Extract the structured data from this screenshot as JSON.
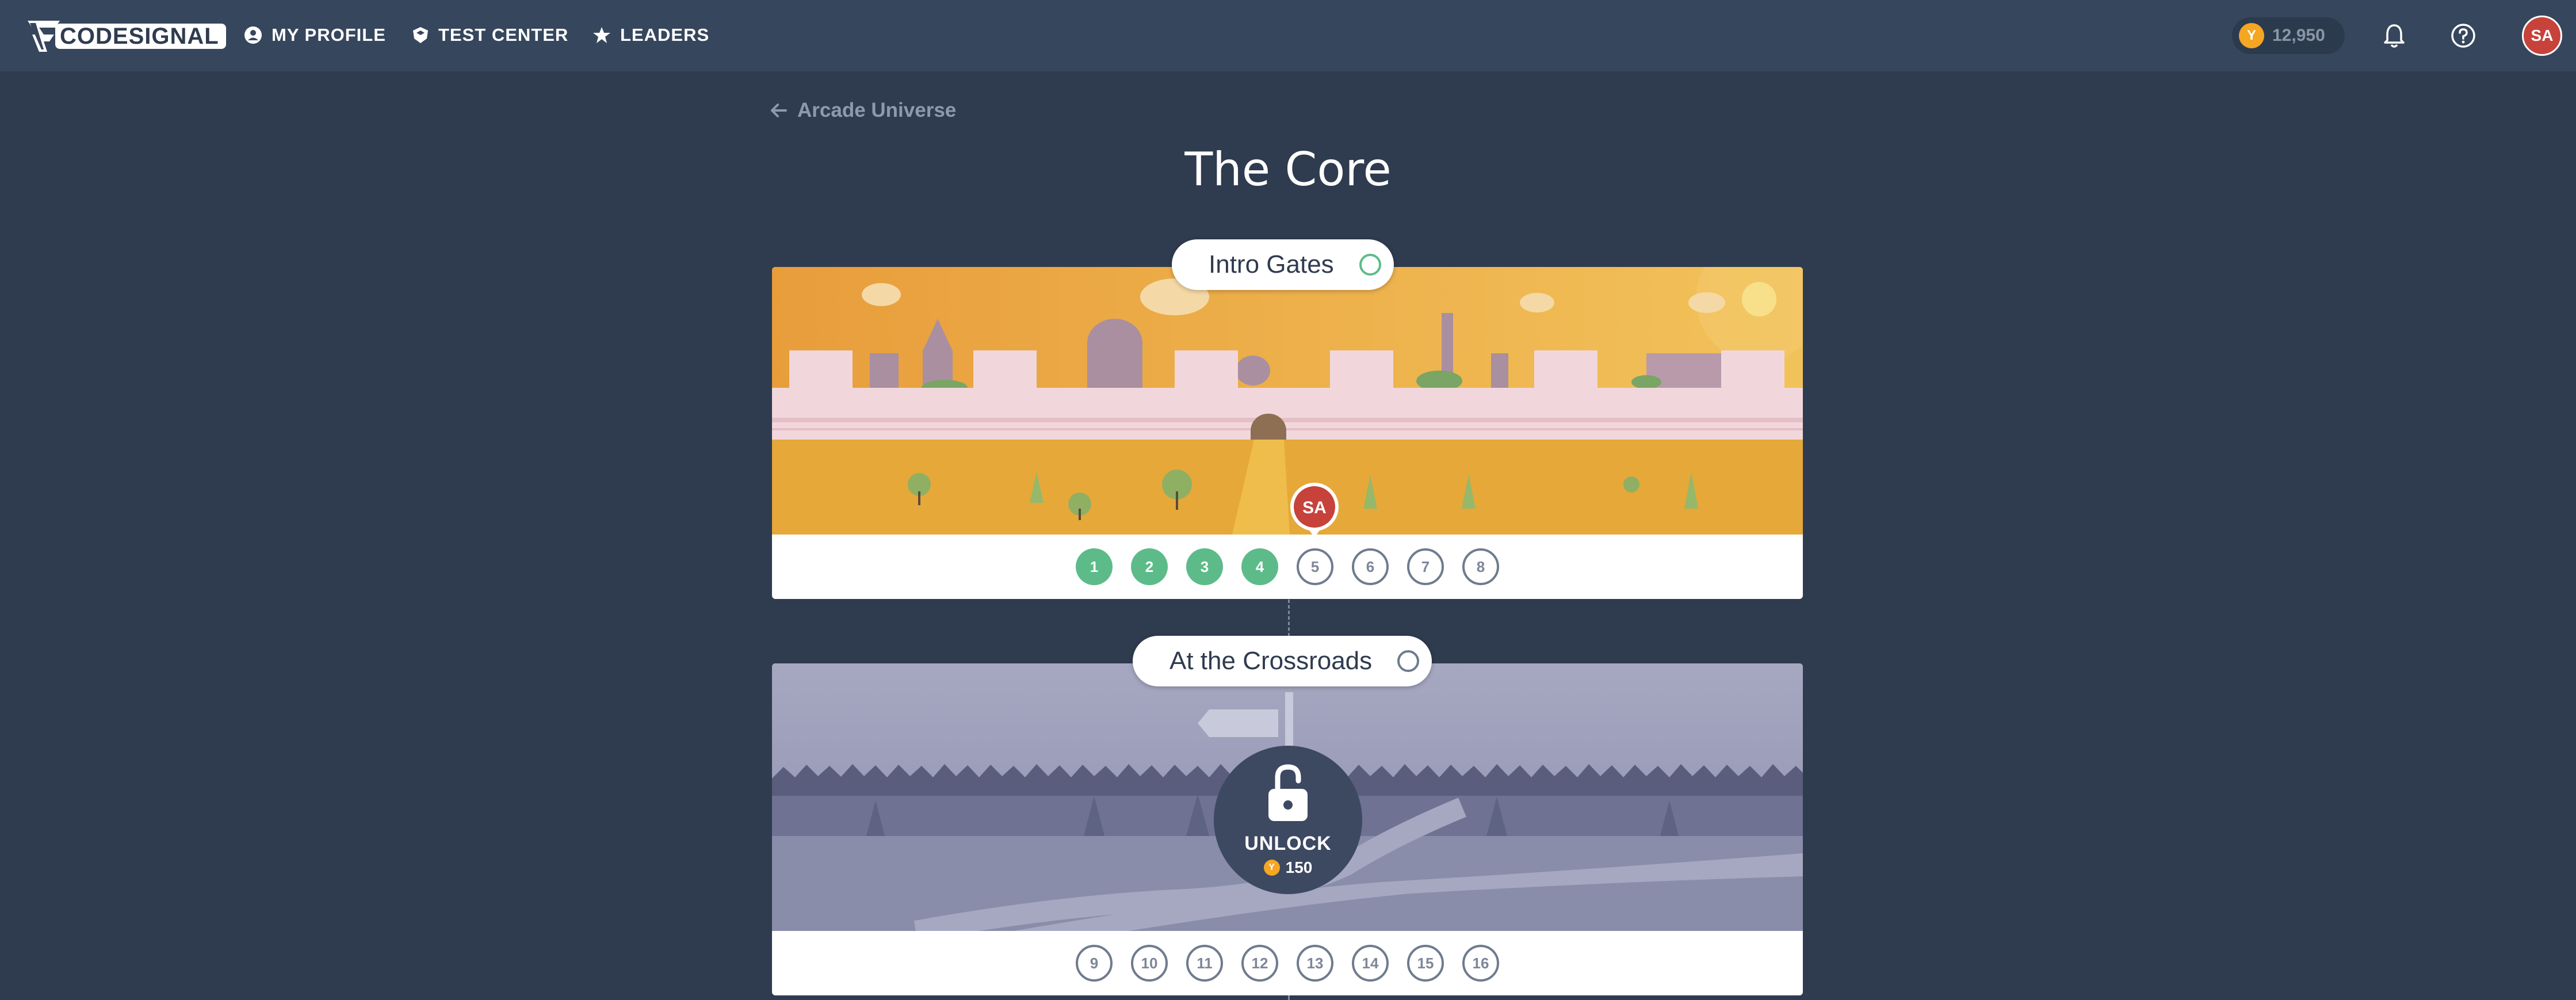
{
  "header": {
    "logo_text": "CODESIGNAL",
    "nav": [
      {
        "label": "MY PROFILE",
        "icon": "user-circle-icon"
      },
      {
        "label": "TEST CENTER",
        "icon": "shield-icon"
      },
      {
        "label": "LEADERS",
        "icon": "star-icon"
      }
    ],
    "coins": "12,950",
    "avatar_initials": "SA"
  },
  "breadcrumb": {
    "back_label": "Arcade Universe"
  },
  "page": {
    "title": "The Core"
  },
  "sections": [
    {
      "title": "Intro Gates",
      "status_color": "#5dbb8a",
      "levels": [
        {
          "n": "1",
          "done": true
        },
        {
          "n": "2",
          "done": true
        },
        {
          "n": "3",
          "done": true
        },
        {
          "n": "4",
          "done": true
        },
        {
          "n": "5",
          "done": false
        },
        {
          "n": "6",
          "done": false
        },
        {
          "n": "7",
          "done": false
        },
        {
          "n": "8",
          "done": false
        }
      ],
      "marker_initials": "SA"
    },
    {
      "title": "At the Crossroads",
      "status_color": "#6f7b8e",
      "unlock_label": "UNLOCK",
      "unlock_cost": "150",
      "levels": [
        {
          "n": "9"
        },
        {
          "n": "10"
        },
        {
          "n": "11"
        },
        {
          "n": "12"
        },
        {
          "n": "13"
        },
        {
          "n": "14"
        },
        {
          "n": "15"
        },
        {
          "n": "16"
        }
      ]
    }
  ],
  "colors": {
    "background": "#2f3b4f",
    "topbar": "#36465d",
    "accent_green": "#5dbb8a",
    "coin": "#f5a623",
    "avatar": "#c6423b"
  }
}
